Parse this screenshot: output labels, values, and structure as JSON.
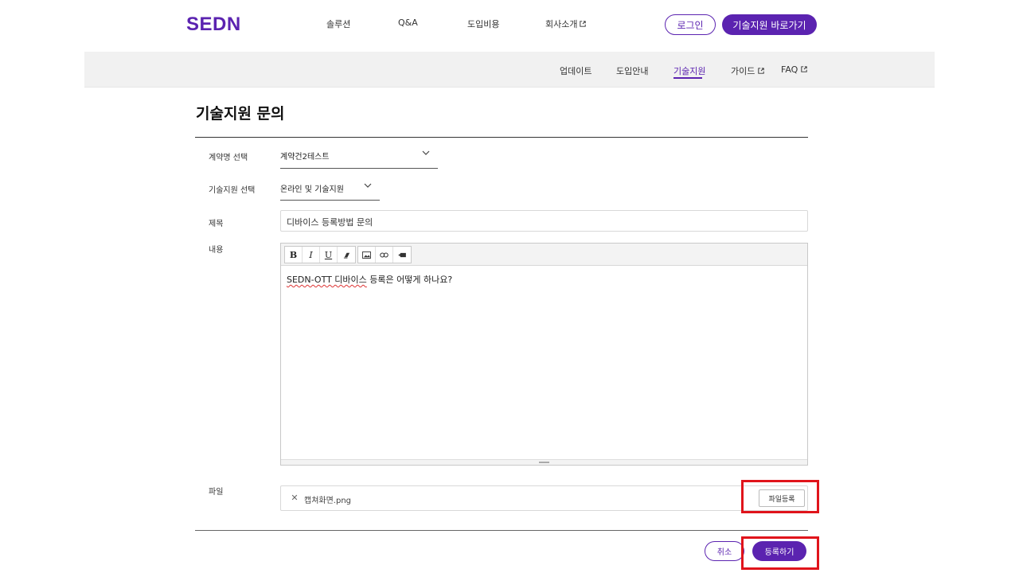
{
  "colors": {
    "brand": "#5b23b0",
    "highlight": "#e0141b"
  },
  "header": {
    "logo": "SEDN",
    "nav": [
      {
        "label": "솔루션"
      },
      {
        "label": "Q&A"
      },
      {
        "label": "도입비용"
      },
      {
        "label": "회사소개",
        "icon": "external-link-icon"
      }
    ],
    "login_label": "로그인",
    "support_label": "기술지원 바로가기"
  },
  "subnav": {
    "items": [
      {
        "label": "업데이트"
      },
      {
        "label": "도입안내"
      },
      {
        "label": "기술지원",
        "active": true
      },
      {
        "label": "가이드",
        "icon": "external-link-icon"
      },
      {
        "label": "FAQ",
        "icon": "external-link-icon"
      }
    ]
  },
  "page": {
    "title": "기술지원 문의"
  },
  "form": {
    "contract": {
      "label": "계약명 선택",
      "value": "계약건2테스트"
    },
    "support_type": {
      "label": "기술지원 선택",
      "value": "온라인 및 기술지원"
    },
    "subject": {
      "label": "제목",
      "value": "디바이스 등록방법 문의"
    },
    "content": {
      "label": "내용",
      "toolbar": [
        "bold-icon",
        "italic-icon",
        "underline-icon",
        "eraser-icon",
        "image-icon",
        "link-icon",
        "video-icon"
      ],
      "body_prefix": "SEDN-OTT 디바이스",
      "body_suffix": " 등록은 어떻게 하나요?"
    },
    "file": {
      "label": "파일",
      "name": "캡쳐화면.png",
      "button_label": "파일등록"
    }
  },
  "actions": {
    "cancel_label": "취소",
    "submit_label": "등록하기"
  }
}
